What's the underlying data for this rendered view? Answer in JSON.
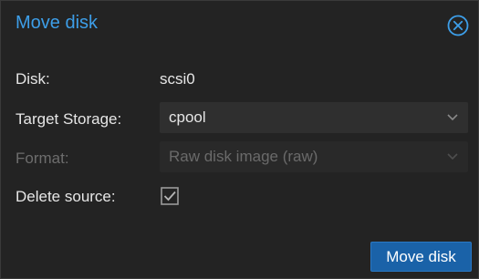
{
  "dialog": {
    "title": "Move disk",
    "close_icon": "close-circle-icon"
  },
  "form": {
    "disk": {
      "label": "Disk:",
      "value": "scsi0"
    },
    "target_storage": {
      "label": "Target Storage:",
      "value": "cpool",
      "disabled": false
    },
    "format": {
      "label": "Format:",
      "value": "Raw disk image (raw)",
      "disabled": true
    },
    "delete_source": {
      "label": "Delete source:",
      "checked": true
    }
  },
  "actions": {
    "submit_label": "Move disk"
  },
  "colors": {
    "background": "#232323",
    "title": "#3d9ee8",
    "primary_button": "#1a62a8",
    "text": "#e6e6e6",
    "disabled_text": "#6d6d6d"
  }
}
